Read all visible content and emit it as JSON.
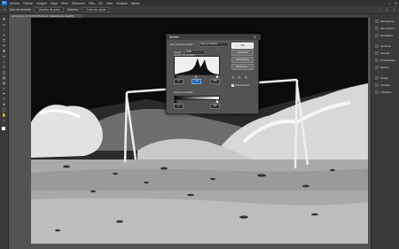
{
  "app": {
    "logo": "Ps",
    "menu": [
      "Archivo",
      "Edición",
      "Imagen",
      "Capa",
      "Texto",
      "Selección",
      "Filtro",
      "3D",
      "Vista",
      "Ventana",
      "Ayuda"
    ],
    "window_controls": [
      "–",
      "□",
      "✕"
    ]
  },
  "options": {
    "preset_label": "Tam. de muestra:",
    "preset_value": "Muestra de punto",
    "sample_label": "Muestra:",
    "sample_value": "Todas las capas",
    "workspace_icons": [
      "⌕",
      "▭",
      "⇪"
    ]
  },
  "tab": {
    "label": "porteria.jpg al 33,3% (Niveles 1, Máscara de capa/8)"
  },
  "panels": [
    {
      "label": "Histograma"
    },
    {
      "label": "Información"
    },
    {
      "label": "Navegador"
    },
    {
      "label": "Acciones"
    },
    {
      "label": "Historia"
    },
    {
      "label": "Propiedades"
    },
    {
      "label": "Ajustes"
    },
    {
      "label": "Capas"
    },
    {
      "label": "Canales"
    },
    {
      "label": "Trazados"
    }
  ],
  "dialog": {
    "title": "Niveles",
    "close": "✕",
    "preset_label": "Valor predeterminado:",
    "preset_value": "Valor por defecto",
    "channel_label": "Canal:",
    "channel_value": "RGB",
    "levels_label": "Niveles de entrada:",
    "input_values": [
      "0",
      "1,00",
      "255"
    ],
    "output_label": "Niveles de salida:",
    "output_values": [
      "0",
      "255"
    ],
    "buttons": {
      "ok": "OK",
      "cancel": "Cancelar",
      "auto": "Automático",
      "options": "Opciones..."
    },
    "preview_label": "Previsualizar",
    "preview_checked": "✓"
  }
}
